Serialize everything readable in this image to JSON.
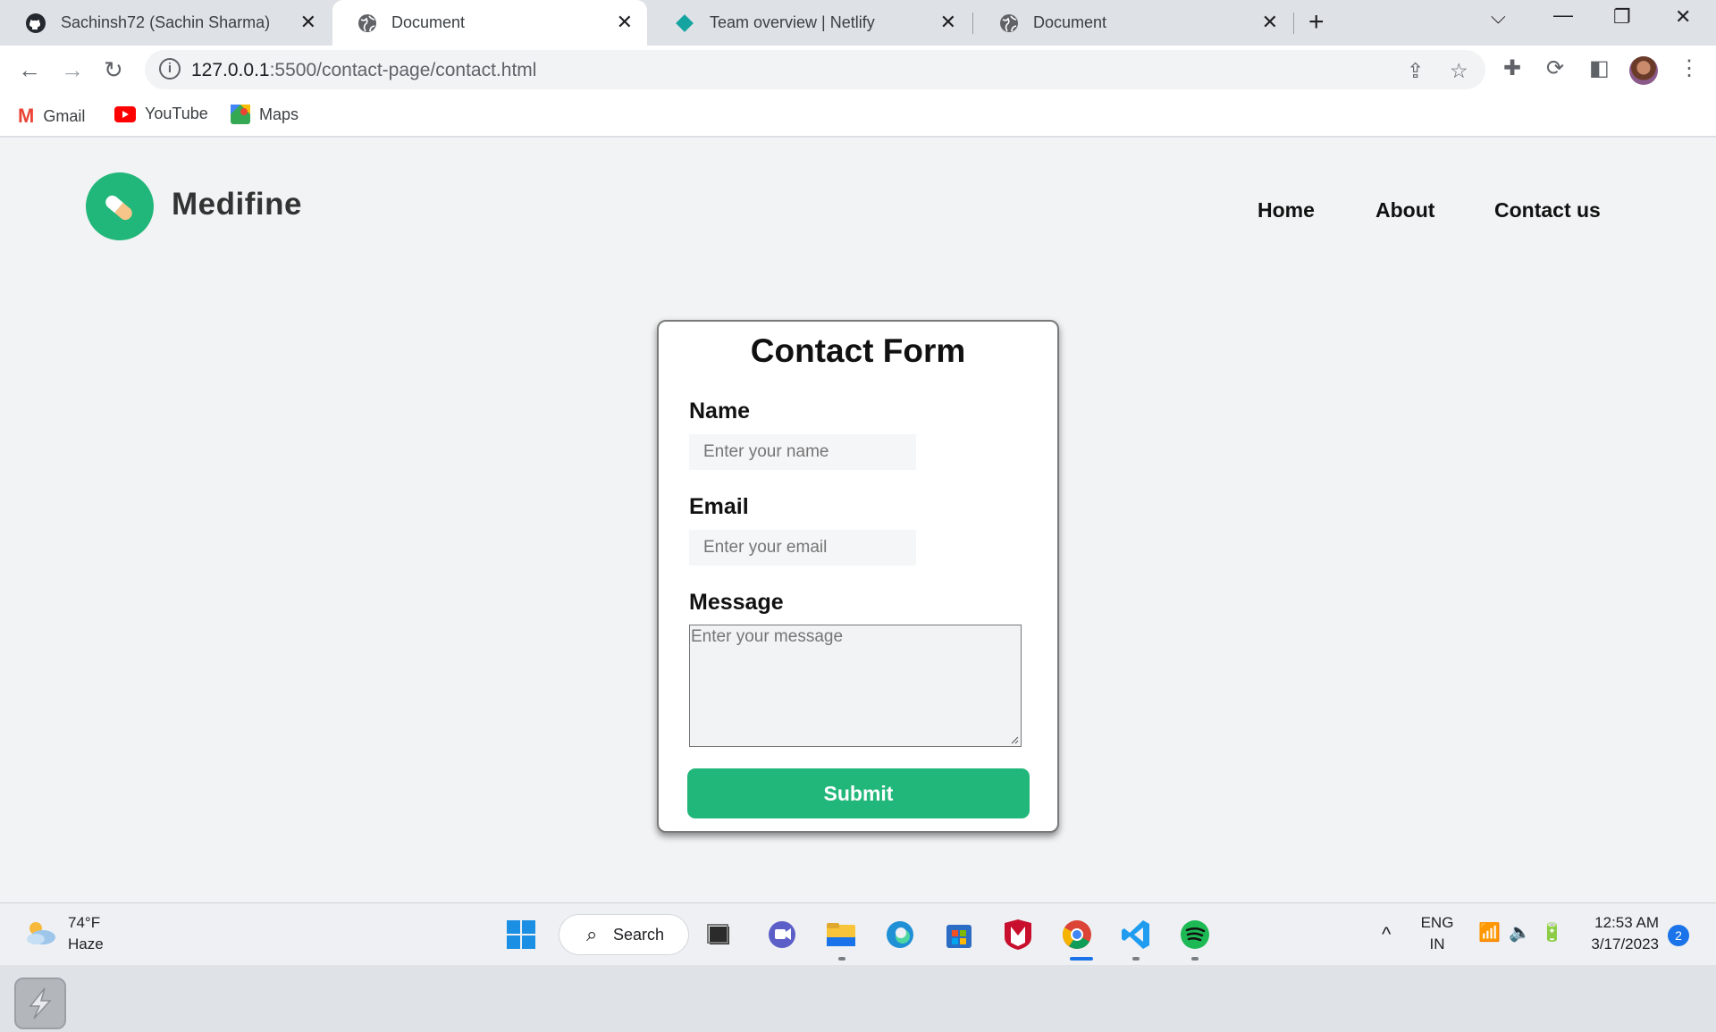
{
  "browser": {
    "tabs": [
      {
        "title": "Sachinsh72 (Sachin Sharma)",
        "icon": "github-icon",
        "active": false
      },
      {
        "title": "Document",
        "icon": "globe-icon",
        "active": true
      },
      {
        "title": "Team overview | Netlify",
        "icon": "netlify-icon",
        "active": false
      },
      {
        "title": "Document",
        "icon": "globe-icon",
        "active": false
      }
    ],
    "url_host": "127.0.0.1",
    "url_path": ":5500/contact-page/contact.html",
    "bookmarks": [
      {
        "label": "Gmail",
        "icon": "gmail-icon",
        "color": "#ea4335"
      },
      {
        "label": "YouTube",
        "icon": "youtube-icon",
        "color": "#ff0000"
      },
      {
        "label": "Maps",
        "icon": "maps-icon",
        "color": "#34a853"
      }
    ]
  },
  "site": {
    "brand": "Medifine",
    "brand_color": "#22b77a",
    "nav": [
      {
        "label": "Home"
      },
      {
        "label": "About"
      },
      {
        "label": "Contact us"
      }
    ]
  },
  "contact_form": {
    "title": "Contact Form",
    "name_label": "Name",
    "name_placeholder": "Enter your name",
    "email_label": "Email",
    "email_placeholder": "Enter your email",
    "message_label": "Message",
    "message_placeholder": "Enter your message",
    "submit_label": "Submit"
  },
  "taskbar": {
    "weather_temp": "74°F",
    "weather_cond": "Haze",
    "search_label": "Search",
    "lang_top": "ENG",
    "lang_bottom": "IN",
    "time": "12:53 AM",
    "date": "3/17/2023",
    "notification_count": "2"
  }
}
